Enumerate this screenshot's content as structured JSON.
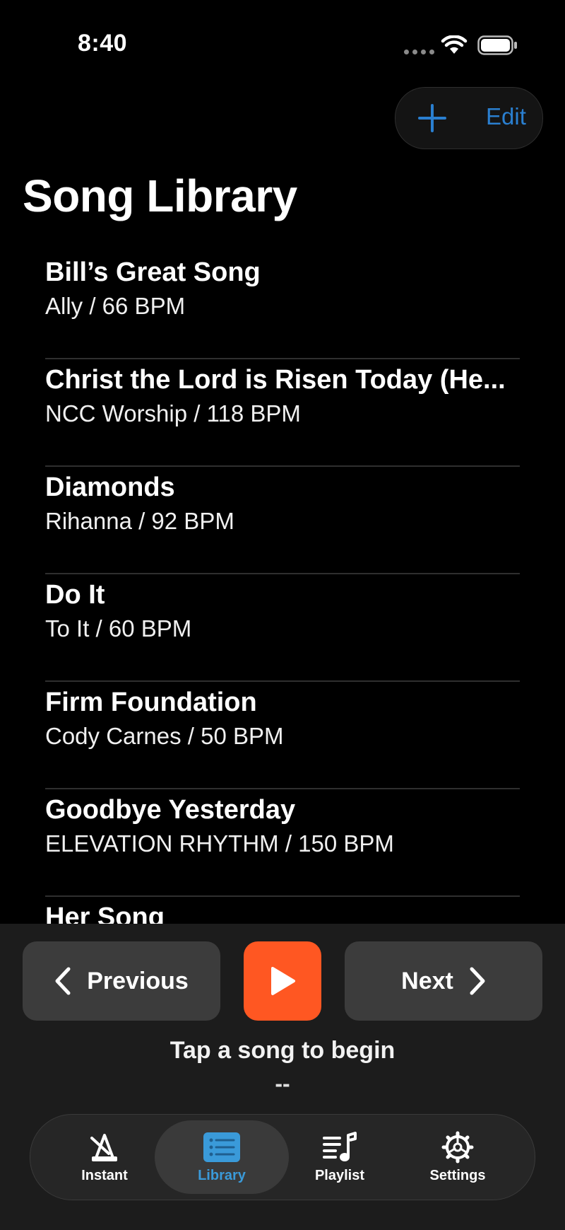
{
  "status_bar": {
    "time": "8:40"
  },
  "header": {
    "edit_label": "Edit",
    "title": "Song Library"
  },
  "songs": [
    {
      "title": "Bill’s Great Song",
      "subtitle": "Ally /  66 BPM"
    },
    {
      "title": "Christ the Lord is Risen Today (He...",
      "subtitle": "NCC Worship /  118 BPM"
    },
    {
      "title": "Diamonds",
      "subtitle": "Rihanna /  92 BPM"
    },
    {
      "title": "Do It",
      "subtitle": "To It /  60 BPM"
    },
    {
      "title": "Firm Foundation",
      "subtitle": "Cody Carnes /  50 BPM"
    },
    {
      "title": "Goodbye Yesterday",
      "subtitle": "ELEVATION RHYTHM /  150 BPM"
    },
    {
      "title": "Her Song",
      "subtitle": ""
    }
  ],
  "player": {
    "previous_label": "Previous",
    "next_label": "Next",
    "status_message": "Tap a song to begin",
    "status_value": "--"
  },
  "tabs": [
    {
      "label": "Instant",
      "icon": "metronome-icon",
      "active": false
    },
    {
      "label": "Library",
      "icon": "list-icon",
      "active": true
    },
    {
      "label": "Playlist",
      "icon": "music-list-icon",
      "active": false
    },
    {
      "label": "Settings",
      "icon": "gear-icon",
      "active": false
    }
  ],
  "colors": {
    "accent_blue": "#2a7fd0",
    "play_orange": "#ff5722",
    "background": "#000000",
    "panel": "#1c1c1c"
  }
}
